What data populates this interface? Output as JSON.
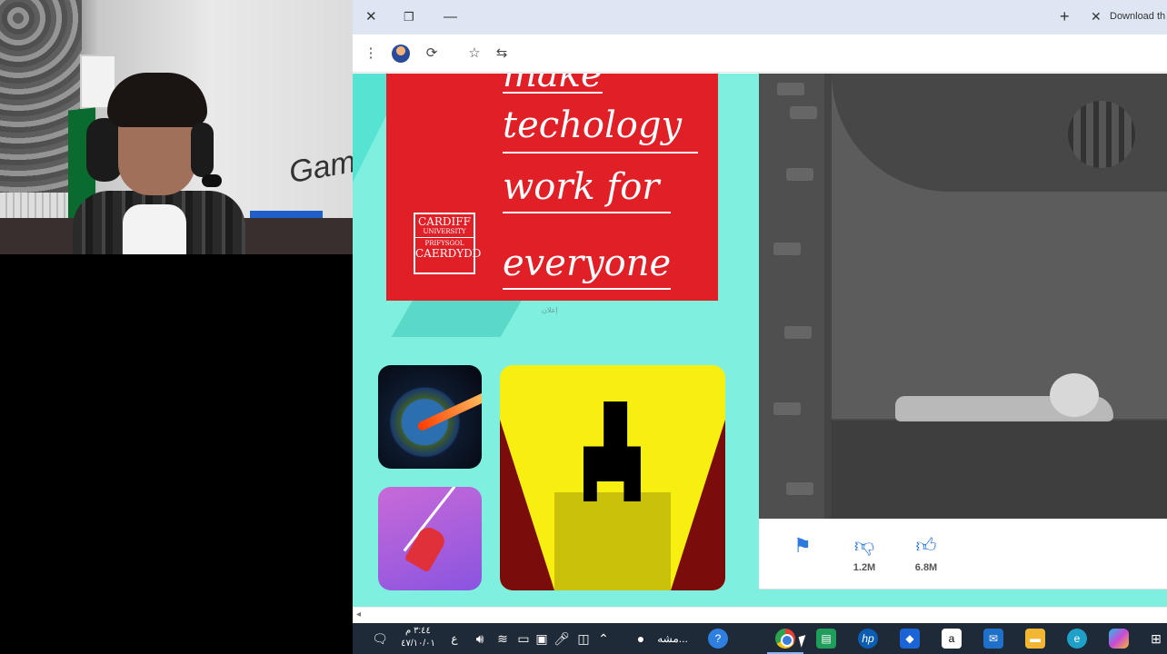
{
  "browser": {
    "tab_title": "Download th",
    "window_controls": {
      "close": "✕",
      "restore": "❐",
      "minimize": "—"
    },
    "new_tab": "+",
    "tab_close": "✕"
  },
  "ad": {
    "lines": [
      "make",
      "techology",
      "work for",
      "everyone"
    ],
    "logo": {
      "line1": "CARDIFF",
      "line2": "UNIVERSITY",
      "line3": "PRIFYSGOL",
      "line4": "CAERDYDD"
    },
    "note": "إعلان"
  },
  "games": [
    {
      "name": "earth-laser-game"
    },
    {
      "name": "stickman-hook-game"
    },
    {
      "name": "escape-game"
    }
  ],
  "player": {
    "dislikes": "1.2M",
    "likes": "6.8M"
  },
  "webcam": {
    "wall_text": "Gam"
  },
  "taskbar": {
    "time": "٣:٤٤ م",
    "date": "٤٧/١٠/٠١",
    "lang": "ع",
    "search_app_label": "مشه..."
  },
  "icons": {
    "menu": "more-vert-icon",
    "profile": "avatar-icon",
    "extension": "extension-icon",
    "bookmark": "star-icon",
    "cast": "tab-icon",
    "flag": "flag-icon",
    "dislike": "thumbs-down-icon",
    "like": "thumbs-up-icon"
  },
  "colors": {
    "ad_red": "#e01f26",
    "page_bg": "#7ff0df",
    "accent_blue": "#2e7be0",
    "taskbar_bg": "#1f2a38"
  }
}
